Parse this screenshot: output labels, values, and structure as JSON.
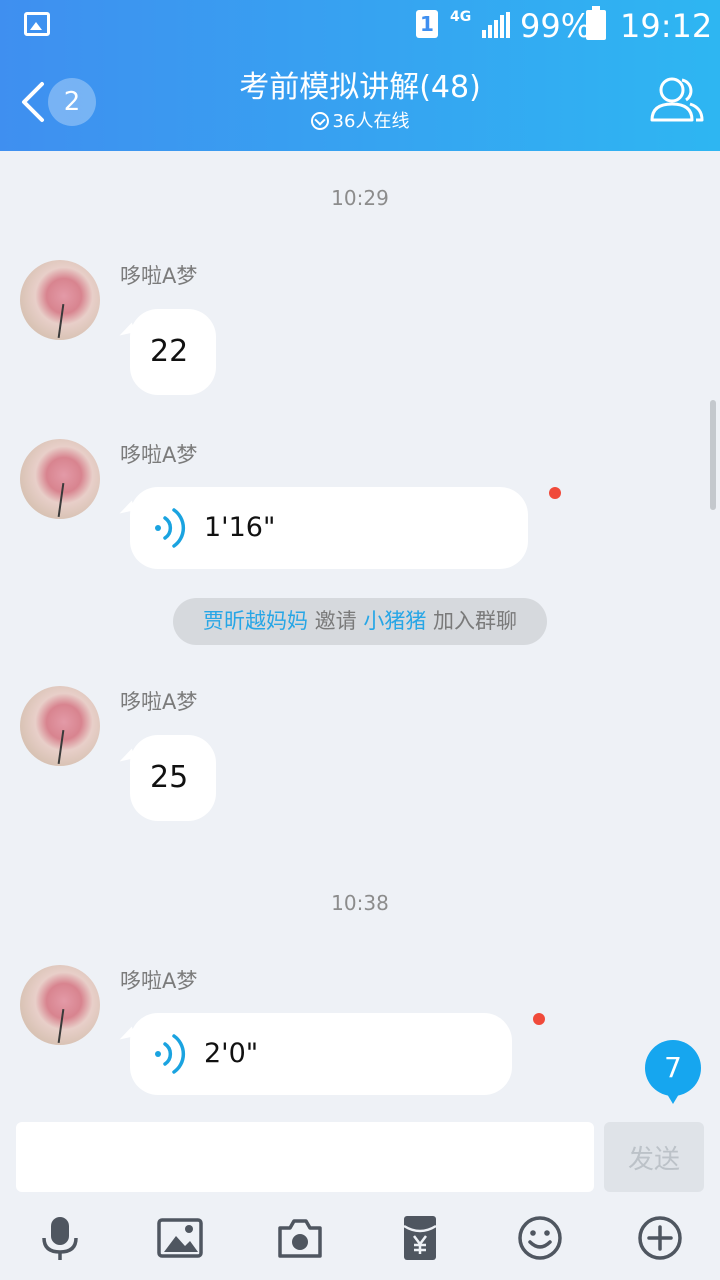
{
  "status_bar": {
    "sim": "1",
    "network": "4G",
    "battery": "99%",
    "time": "19:12"
  },
  "header": {
    "back_badge": "2",
    "title": "考前模拟讲解(48)",
    "online": "36人在线"
  },
  "messages": [
    {
      "type": "timestamp",
      "text": "10:29"
    },
    {
      "type": "text",
      "sender": "哆啦A梦",
      "text": "22"
    },
    {
      "type": "voice",
      "sender": "哆啦A梦",
      "duration": "1'16\"",
      "unread": true
    },
    {
      "type": "system",
      "inviter": "贾昕越妈妈",
      "verb": "邀请",
      "invitee": "小猪猪",
      "suffix": "加入群聊"
    },
    {
      "type": "text",
      "sender": "哆啦A梦",
      "text": "25"
    },
    {
      "type": "timestamp",
      "text": "10:38"
    },
    {
      "type": "voice",
      "sender": "哆啦A梦",
      "duration": "2'0\"",
      "unread": true
    }
  ],
  "new_messages_badge": "7",
  "input": {
    "value": "",
    "placeholder": "",
    "send_label": "发送"
  },
  "toolbar": [
    "mic-icon",
    "image-icon",
    "camera-icon",
    "red-packet-icon",
    "emoji-icon",
    "plus-icon"
  ],
  "colors": {
    "header_start": "#3f8ff0",
    "header_end": "#2eb6f2",
    "accent": "#27a6e6",
    "unread_dot": "#f04a3a",
    "background": "#eef1f6"
  }
}
